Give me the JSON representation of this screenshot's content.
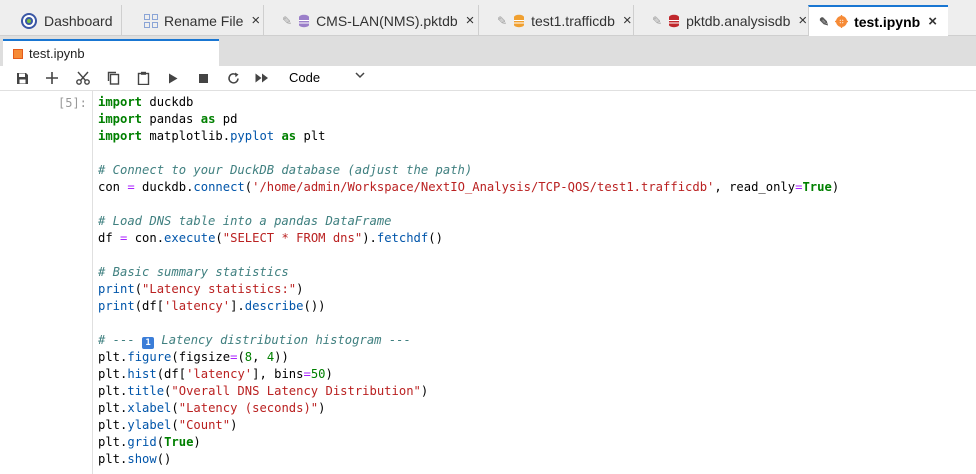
{
  "tabs": [
    {
      "label": "Dashboard",
      "icon": "dashboard-icon",
      "closable": false,
      "pinned": false,
      "active": false
    },
    {
      "label": "Rename File",
      "icon": "rename-icon",
      "closable": true,
      "pinned": false,
      "active": false
    },
    {
      "label": "CMS-LAN(NMS).pktdb",
      "icon": "database-icon",
      "closable": true,
      "pinned": true,
      "active": false
    },
    {
      "label": "test1.trafficdb",
      "icon": "database-icon",
      "closable": true,
      "pinned": true,
      "active": false
    },
    {
      "label": "pktdb.analysisdb",
      "icon": "database-icon",
      "closable": true,
      "pinned": true,
      "active": false
    },
    {
      "label": "test.ipynb",
      "icon": "notebook-icon",
      "closable": true,
      "pinned": true,
      "active": true
    }
  ],
  "close_glyph": "×",
  "doc_tab": {
    "label": "test.ipynb"
  },
  "toolbar": {
    "kernel_mode": "Code"
  },
  "cell": {
    "prompt": "[5]:",
    "lines": [
      [
        {
          "t": "kw",
          "v": "import"
        },
        {
          "t": "",
          "v": " duckdb"
        }
      ],
      [
        {
          "t": "kw",
          "v": "import"
        },
        {
          "t": "",
          "v": " pandas "
        },
        {
          "t": "kw",
          "v": "as"
        },
        {
          "t": "",
          "v": " pd"
        }
      ],
      [
        {
          "t": "kw",
          "v": "import"
        },
        {
          "t": "",
          "v": " matplotlib"
        },
        {
          "t": "",
          "v": "."
        },
        {
          "t": "fn",
          "v": "pyplot"
        },
        {
          "t": "",
          "v": " "
        },
        {
          "t": "kw",
          "v": "as"
        },
        {
          "t": "",
          "v": " plt"
        }
      ],
      [],
      [
        {
          "t": "cm",
          "v": "# Connect to your DuckDB database (adjust the path)"
        }
      ],
      [
        {
          "t": "",
          "v": "con "
        },
        {
          "t": "op",
          "v": "="
        },
        {
          "t": "",
          "v": " duckdb."
        },
        {
          "t": "fn",
          "v": "connect"
        },
        {
          "t": "",
          "v": "("
        },
        {
          "t": "st",
          "v": "'/home/admin/Workspace/NextIO_Analysis/TCP-QOS/test1.trafficdb'"
        },
        {
          "t": "",
          "v": ", read_only"
        },
        {
          "t": "op",
          "v": "="
        },
        {
          "t": "bool",
          "v": "True"
        },
        {
          "t": "",
          "v": ")"
        }
      ],
      [],
      [
        {
          "t": "cm",
          "v": "# Load DNS table into a pandas DataFrame"
        }
      ],
      [
        {
          "t": "",
          "v": "df "
        },
        {
          "t": "op",
          "v": "="
        },
        {
          "t": "",
          "v": " con."
        },
        {
          "t": "fn",
          "v": "execute"
        },
        {
          "t": "",
          "v": "("
        },
        {
          "t": "st",
          "v": "\"SELECT * FROM dns\""
        },
        {
          "t": "",
          "v": ")."
        },
        {
          "t": "fn",
          "v": "fetchdf"
        },
        {
          "t": "",
          "v": "()"
        }
      ],
      [],
      [
        {
          "t": "cm",
          "v": "# Basic summary statistics"
        }
      ],
      [
        {
          "t": "fn",
          "v": "print"
        },
        {
          "t": "",
          "v": "("
        },
        {
          "t": "st",
          "v": "\"Latency statistics:\""
        },
        {
          "t": "",
          "v": ")"
        }
      ],
      [
        {
          "t": "fn",
          "v": "print"
        },
        {
          "t": "",
          "v": "(df["
        },
        {
          "t": "st",
          "v": "'latency'"
        },
        {
          "t": "",
          "v": "]."
        },
        {
          "t": "fn",
          "v": "describe"
        },
        {
          "t": "",
          "v": "())"
        }
      ],
      [],
      [
        {
          "t": "cm",
          "v": "# --- "
        },
        {
          "t": "emoji",
          "v": "1"
        },
        {
          "t": "cm",
          "v": " Latency distribution histogram ---"
        }
      ],
      [
        {
          "t": "",
          "v": "plt."
        },
        {
          "t": "fn",
          "v": "figure"
        },
        {
          "t": "",
          "v": "(figsize"
        },
        {
          "t": "op",
          "v": "="
        },
        {
          "t": "",
          "v": "("
        },
        {
          "t": "num",
          "v": "8"
        },
        {
          "t": "",
          "v": ", "
        },
        {
          "t": "num",
          "v": "4"
        },
        {
          "t": "",
          "v": "))"
        }
      ],
      [
        {
          "t": "",
          "v": "plt."
        },
        {
          "t": "fn",
          "v": "hist"
        },
        {
          "t": "",
          "v": "(df["
        },
        {
          "t": "st",
          "v": "'latency'"
        },
        {
          "t": "",
          "v": "], bins"
        },
        {
          "t": "op",
          "v": "="
        },
        {
          "t": "num",
          "v": "50"
        },
        {
          "t": "",
          "v": ")"
        }
      ],
      [
        {
          "t": "",
          "v": "plt."
        },
        {
          "t": "fn",
          "v": "title"
        },
        {
          "t": "",
          "v": "("
        },
        {
          "t": "st",
          "v": "\"Overall DNS Latency Distribution\""
        },
        {
          "t": "",
          "v": ")"
        }
      ],
      [
        {
          "t": "",
          "v": "plt."
        },
        {
          "t": "fn",
          "v": "xlabel"
        },
        {
          "t": "",
          "v": "("
        },
        {
          "t": "st",
          "v": "\"Latency (seconds)\""
        },
        {
          "t": "",
          "v": ")"
        }
      ],
      [
        {
          "t": "",
          "v": "plt."
        },
        {
          "t": "fn",
          "v": "ylabel"
        },
        {
          "t": "",
          "v": "("
        },
        {
          "t": "st",
          "v": "\"Count\""
        },
        {
          "t": "",
          "v": ")"
        }
      ],
      [
        {
          "t": "",
          "v": "plt."
        },
        {
          "t": "fn",
          "v": "grid"
        },
        {
          "t": "",
          "v": "("
        },
        {
          "t": "bool",
          "v": "True"
        },
        {
          "t": "",
          "v": ")"
        }
      ],
      [
        {
          "t": "",
          "v": "plt."
        },
        {
          "t": "fn",
          "v": "show"
        },
        {
          "t": "",
          "v": "()"
        }
      ]
    ]
  },
  "colors": {
    "accent": "#1976d2",
    "notebook_icon": "#f68b37",
    "keyword": "#008000",
    "string": "#ba2121",
    "comment": "#408080"
  }
}
